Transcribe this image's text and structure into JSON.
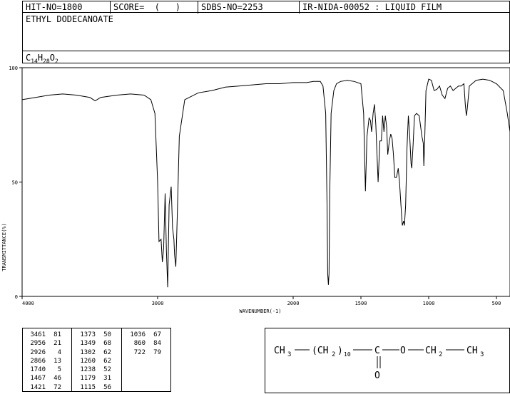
{
  "header": {
    "hit_no": "HIT-NO=1800",
    "score": "SCORE=  (   )",
    "sdbs_no": "SDBS-NO=2253",
    "ir_id": "IR-NIDA-00052 : LIQUID FILM"
  },
  "compound_name": "ETHYL DODECANOATE",
  "formula": {
    "c": "C",
    "c_count": "14",
    "h": "H",
    "h_count": "28",
    "o": "O",
    "o_count": "2"
  },
  "chart_data": {
    "type": "line",
    "ylabel": "TRANSMITTANCE(%)",
    "xlabel": "WAVENUMBER(-1)",
    "xlim": [
      4000,
      400
    ],
    "ylim": [
      0,
      100
    ],
    "x_tick_labels": [
      "4000",
      "3000",
      "2000",
      "1500",
      "1000",
      "500"
    ],
    "x_tick_values": [
      4000,
      3000,
      2000,
      1500,
      1000,
      500
    ],
    "y_tick_labels": [
      "100",
      "50",
      "0"
    ],
    "y_tick_values": [
      100,
      50,
      0
    ],
    "series": [
      {
        "x": [
          4000,
          3900,
          3800,
          3700,
          3600,
          3500,
          3461,
          3420,
          3300,
          3200,
          3100,
          3050,
          3020,
          3000,
          2990,
          2975,
          2965,
          2956,
          2945,
          2935,
          2926,
          2915,
          2900,
          2890,
          2880,
          2875,
          2866,
          2855,
          2840,
          2800,
          2700,
          2600,
          2500,
          2400,
          2300,
          2200,
          2100,
          2000,
          1900,
          1850,
          1800,
          1780,
          1760,
          1750,
          1745,
          1740,
          1735,
          1730,
          1720,
          1700,
          1680,
          1650,
          1600,
          1550,
          1500,
          1480,
          1467,
          1455,
          1440,
          1430,
          1421,
          1410,
          1400,
          1390,
          1380,
          1373,
          1360,
          1349,
          1340,
          1330,
          1320,
          1310,
          1302,
          1290,
          1280,
          1270,
          1260,
          1250,
          1238,
          1225,
          1215,
          1205,
          1195,
          1185,
          1179,
          1170,
          1160,
          1150,
          1140,
          1130,
          1125,
          1115,
          1105,
          1090,
          1070,
          1050,
          1040,
          1036,
          1030,
          1020,
          1000,
          980,
          960,
          940,
          920,
          900,
          880,
          860,
          840,
          820,
          800,
          780,
          760,
          740,
          730,
          722,
          715,
          700,
          680,
          650,
          600,
          550,
          500,
          450,
          420,
          400
        ],
        "y": [
          86,
          87,
          88,
          88.5,
          88,
          87,
          85.5,
          87,
          88,
          88.5,
          88,
          86,
          80,
          50,
          24,
          25,
          15,
          21,
          45,
          20,
          4,
          40,
          48,
          30,
          25,
          18,
          13,
          35,
          70,
          86,
          89,
          90,
          91.5,
          92,
          92.5,
          93,
          93,
          93.5,
          93.5,
          94,
          94,
          92,
          80,
          40,
          10,
          5,
          10,
          45,
          80,
          90,
          93,
          94,
          94.5,
          94,
          93,
          80,
          46,
          70,
          78,
          77,
          72,
          80,
          84,
          75,
          60,
          50,
          68,
          68,
          79,
          72,
          79,
          74,
          62,
          68,
          71,
          69,
          62,
          52,
          52,
          56,
          50,
          40,
          31,
          33,
          31,
          40,
          65,
          79,
          70,
          58,
          56,
          66,
          79,
          80,
          79,
          70,
          67,
          57,
          67,
          90,
          95,
          94.5,
          90,
          90.5,
          92,
          88,
          86.5,
          91,
          92,
          90,
          91,
          92,
          92,
          93,
          84,
          79,
          82,
          92,
          93,
          94.5,
          95,
          94.5,
          93,
          90,
          80,
          72
        ]
      }
    ],
    "peak_table": [
      [
        [
          "3461",
          "81"
        ],
        [
          "2956",
          "21"
        ],
        [
          "2926",
          "4"
        ],
        [
          "2866",
          "13"
        ],
        [
          "1740",
          "5"
        ],
        [
          "1467",
          "46"
        ],
        [
          "1421",
          "72"
        ]
      ],
      [
        [
          "1373",
          "50"
        ],
        [
          "1349",
          "68"
        ],
        [
          "1302",
          "62"
        ],
        [
          "1260",
          "62"
        ],
        [
          "1238",
          "52"
        ],
        [
          "1179",
          "31"
        ],
        [
          "1115",
          "56"
        ]
      ],
      [
        [
          "1036",
          "67"
        ],
        [
          "860",
          "84"
        ],
        [
          "722",
          "79"
        ]
      ]
    ]
  },
  "structure": {
    "ch3_left": "CH",
    "sub3_left": "3",
    "ch2": "(CH",
    "sub2": "2",
    "close_paren": ")",
    "sub10": "10",
    "carbon": "C",
    "oxygen_single": "O",
    "ch2_ethyl": "CH",
    "sub2_ethyl": "2",
    "ch3_right": "CH",
    "sub3_right": "3",
    "oxygen_double": "O"
  }
}
